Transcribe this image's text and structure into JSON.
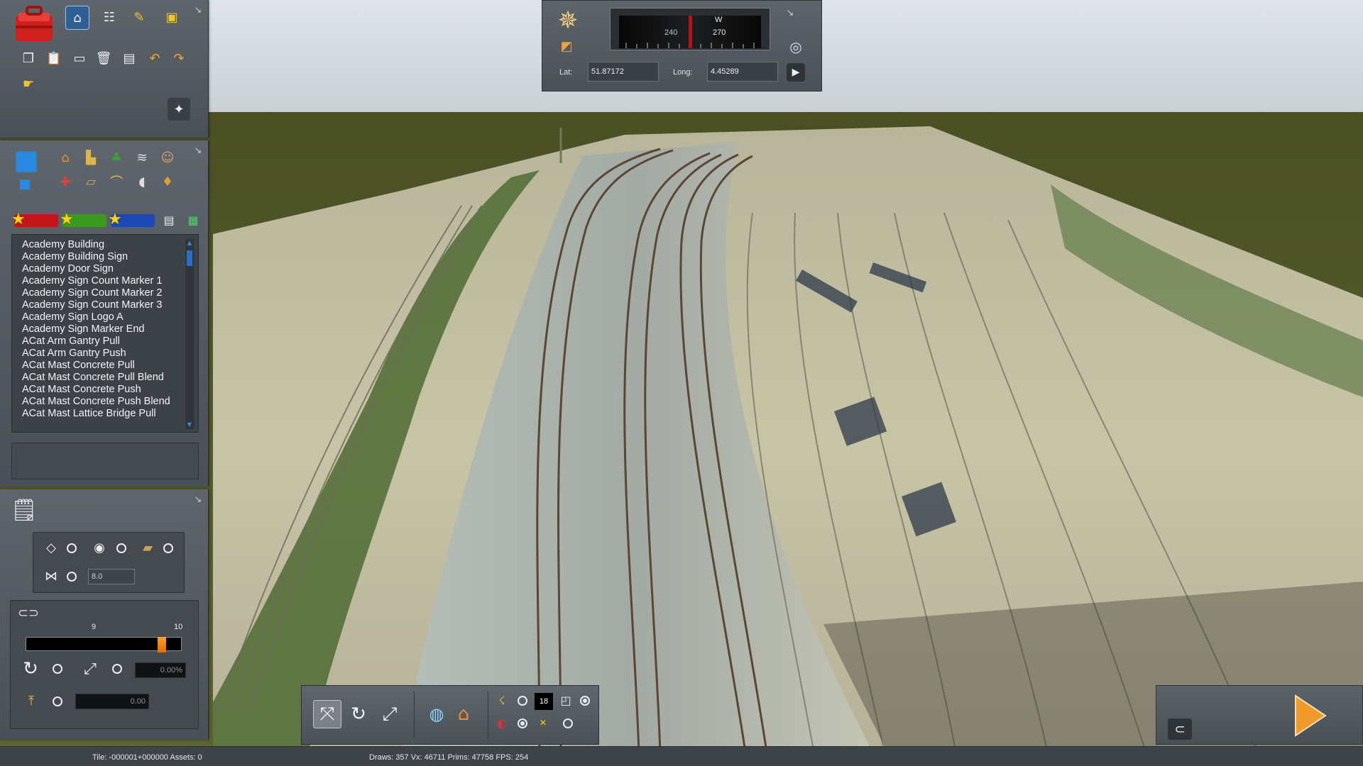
{
  "asset_list": {
    "items": [
      "Academy Building",
      "Academy Building Sign",
      "Academy Door Sign",
      "Academy Sign Count Marker 1",
      "Academy Sign Count Marker 2",
      "Academy Sign Count Marker 3",
      "Academy Sign Logo A",
      "Academy Sign Marker End",
      "ACat Arm Gantry Pull",
      "ACat Arm Gantry Push",
      "ACat Mast Concrete Pull",
      "ACat Mast Concrete Pull Blend",
      "ACat Mast Concrete Push",
      "ACat Mast Concrete Push Blend",
      "ACat Mast Lattice Bridge Pull"
    ]
  },
  "compass": {
    "heading_letter": "W",
    "scale_left": "240",
    "scale_right": "270",
    "lat_label": "Lat:",
    "lat_value": "51.87172",
    "long_label": "Long:",
    "long_value": "4.45289"
  },
  "terrain": {
    "radius_value": "8.0",
    "slider_min_label": "9",
    "slider_max_label": "10",
    "slider_fraction": 0.9,
    "rotate_value": "0.00%",
    "height_value": "0.00"
  },
  "toolbar": {
    "time_value": "18"
  },
  "status": {
    "tile": "Tile: -000001+000000  Assets: 0",
    "stats": "Draws: 357 Vx: 46711 Prims: 47758 FPS: 254"
  },
  "icons": {
    "toolbox": "toolbox-icon",
    "home": "home-icon",
    "track": "track-icon",
    "paint": "paintbrush-icon",
    "train": "train-icon",
    "play": "play-icon"
  },
  "colors": {
    "panel": "#555c63",
    "selection": "#2f5f93",
    "accent": "#ff8c1a",
    "play": "#f19a2a"
  }
}
